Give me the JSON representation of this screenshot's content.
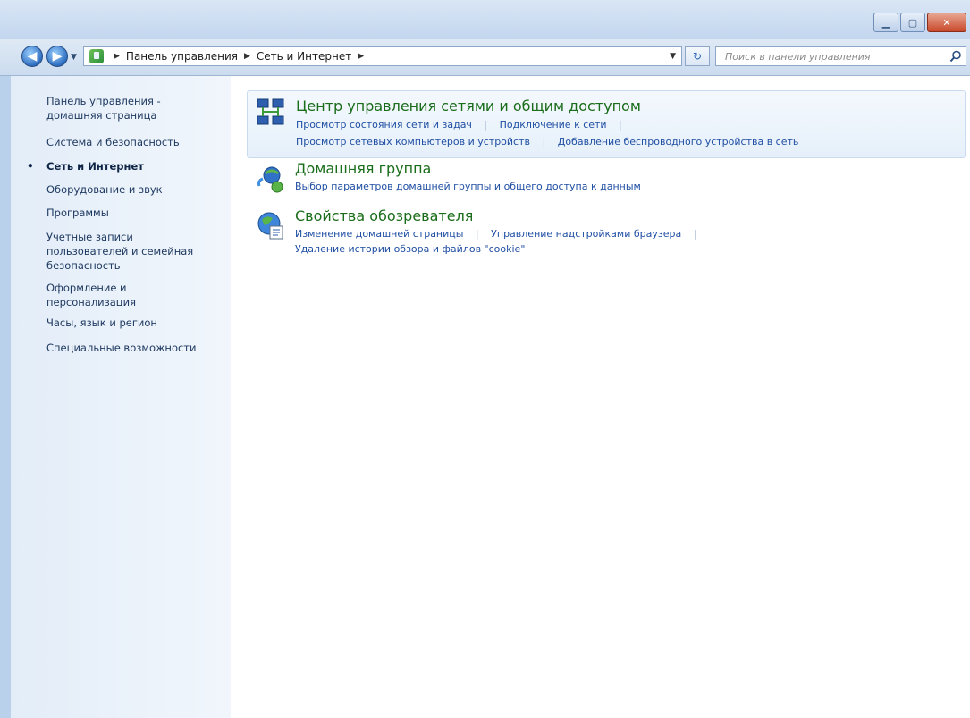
{
  "window": {
    "controls": [
      "minimize-icon",
      "maximize-icon",
      "close-icon"
    ]
  },
  "address_bar": {
    "crumbs": [
      "Панель управления",
      "Сеть и Интернет"
    ]
  },
  "search": {
    "placeholder": "Поиск в панели управления"
  },
  "sidebar": {
    "items": [
      {
        "label": "Панель управления -"
      },
      {
        "label": "домашняя страница"
      },
      {
        "label": "Система и безопасность"
      },
      {
        "label": "Сеть и Интернет",
        "active": true
      },
      {
        "label": "Оборудование и звук"
      },
      {
        "label": "Программы"
      },
      {
        "label": "Учетные записи"
      },
      {
        "label": "пользователей и семейная"
      },
      {
        "label": "безопасность"
      },
      {
        "label": "Оформление и"
      },
      {
        "label": "персонализация"
      },
      {
        "label": "Часы, язык и регион"
      },
      {
        "label": "Специальные возможности"
      }
    ]
  },
  "categories": [
    {
      "title": "Центр управления сетями и общим доступом",
      "icon": "network-center-icon",
      "links": [
        "Просмотр состояния сети и задач",
        "Подключение к сети",
        "Просмотр сетевых компьютеров и устройств",
        "Добавление беспроводного устройства в сеть"
      ]
    },
    {
      "title": "Домашняя группа",
      "icon": "homegroup-icon",
      "links": [
        "Выбор параметров домашней группы и общего доступа к данным"
      ]
    },
    {
      "title": "Свойства обозревателя",
      "icon": "internet-options-icon",
      "links": [
        "Изменение домашней страницы",
        "Управление надстройками браузера",
        "Удаление истории обзора и файлов \"cookie\""
      ]
    }
  ]
}
